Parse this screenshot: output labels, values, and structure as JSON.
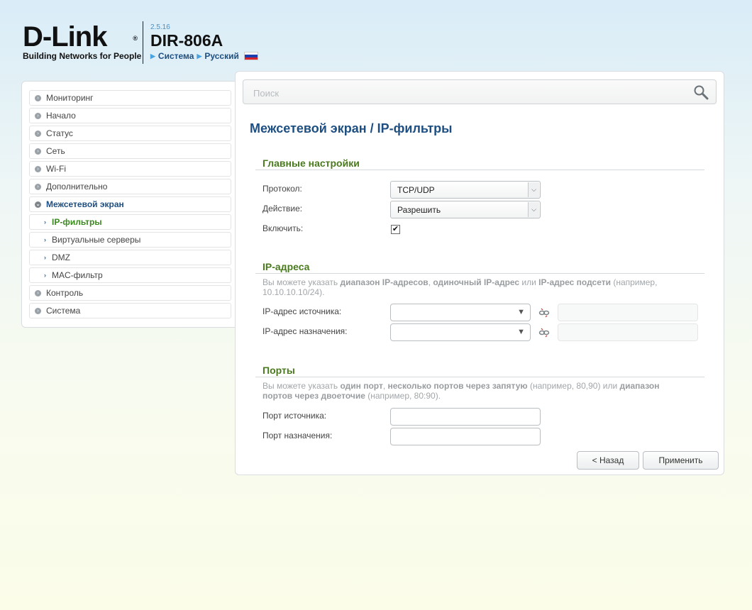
{
  "header": {
    "brand": "D-Link",
    "brand_reg": "®",
    "tagline": "Building Networks for People",
    "firmware_version": "2.5.16",
    "model": "DIR-806A",
    "crumb_system": "Система",
    "crumb_language": "Русский",
    "flag_colors": [
      "#ffffff",
      "#1c3fb0",
      "#d8232a"
    ]
  },
  "sidebar": {
    "items": [
      {
        "label": "Мониторинг"
      },
      {
        "label": "Начало"
      },
      {
        "label": "Статус"
      },
      {
        "label": "Сеть"
      },
      {
        "label": "Wi-Fi"
      },
      {
        "label": "Дополнительно"
      },
      {
        "label": "Межсетевой экран"
      },
      {
        "label": "IP-фильтры"
      },
      {
        "label": "Виртуальные серверы"
      },
      {
        "label": "DMZ"
      },
      {
        "label": "MAC-фильтр"
      },
      {
        "label": "Контроль"
      },
      {
        "label": "Система"
      }
    ]
  },
  "search": {
    "placeholder": "Поиск",
    "icon": "magnifier-icon"
  },
  "page": {
    "title": "Межсетевой экран /  IP-фильтры"
  },
  "main_settings": {
    "title": "Главные настройки",
    "protocol_label": "Протокол:",
    "protocol_value": "TCP/UDP",
    "action_label": "Действие:",
    "action_value": "Разрешить",
    "enable_label": "Включить:",
    "enable_checked": true
  },
  "ip_addresses": {
    "title": "IP-адреса",
    "hint_1": "Вы можете указать ",
    "hint_b1": "диапазон IP-адресов",
    "hint_2": ", ",
    "hint_b2": "одиночный IP-адрес",
    "hint_3": " или ",
    "hint_b3": "IP-адрес подсети",
    "hint_4": " (например, 10.10.10.10/24).",
    "source_label": "IP-адрес источника:",
    "dest_label": "IP-адрес назначения:"
  },
  "ports": {
    "title": "Порты",
    "hint_1": "Вы можете указать ",
    "hint_b1": "один порт",
    "hint_2": ", ",
    "hint_b2": "несколько портов через запятую",
    "hint_3": " (например, 80,90) или ",
    "hint_b3": "диапазон портов через двоеточие",
    "hint_4": " (например, 80:90).",
    "source_label": "Порт источника:",
    "dest_label": "Порт назначения:"
  },
  "buttons": {
    "back": "< Назад",
    "apply": "Применить"
  },
  "colors": {
    "accent_blue": "#1e4f82",
    "section_green": "#4a7a1e",
    "active_item_green": "#3a8a1e"
  }
}
